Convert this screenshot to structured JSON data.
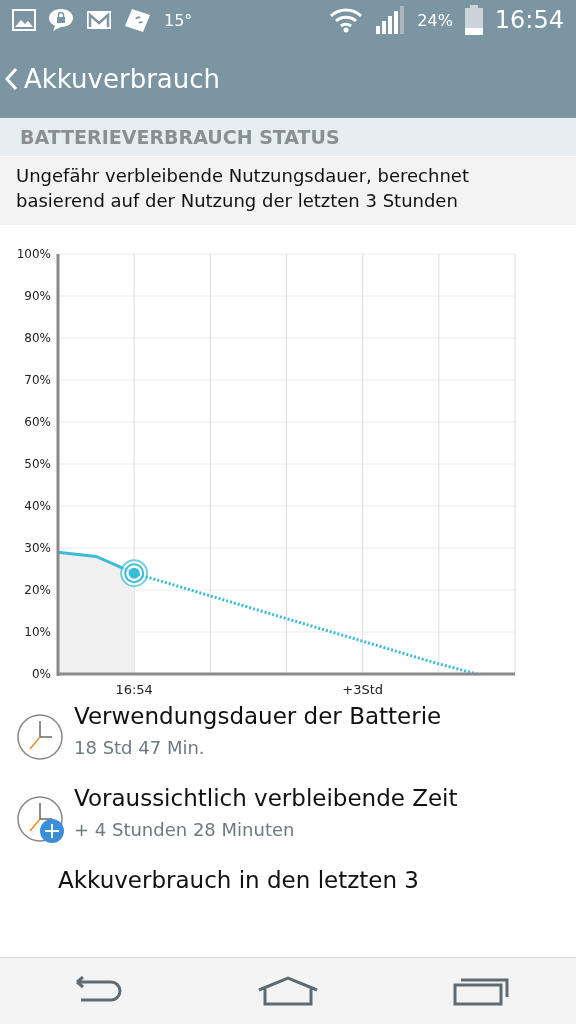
{
  "status_bar": {
    "temperature": "15°",
    "battery_percent": "24%",
    "time": "16:54"
  },
  "title_bar": {
    "title": "Akkuverbrauch"
  },
  "section_header": "BATTERIEVERBRAUCH STATUS",
  "description": "Ungefähr verbleibende Nutzungsdauer, berechnet basierend auf der Nutzung der letzten 3 Stunden",
  "chart": {
    "chart_data": {
      "type": "line",
      "categories": [
        null,
        null,
        "16:54",
        null,
        null,
        null,
        null,
        null,
        "+3Std",
        null,
        null,
        null,
        null
      ],
      "grid": true,
      "series": [
        {
          "color": "#3bbcd6",
          "line_style": "solid",
          "values": [
            29,
            28,
            24,
            null,
            null,
            null,
            null,
            null,
            null,
            null,
            null,
            null,
            null
          ]
        },
        {
          "color": "#3bbcd6",
          "line_style": "dotted",
          "values": [
            null,
            null,
            24,
            21.3,
            18.6,
            15.9,
            13.2,
            10.5,
            7.8,
            5.1,
            2.4,
            0,
            null
          ]
        }
      ],
      "ylim": [
        0,
        100
      ],
      "yticks": [
        {
          "value": 0,
          "label": "0%"
        },
        {
          "value": 10,
          "label": "10%"
        },
        {
          "value": 20,
          "label": "20%"
        },
        {
          "value": 30,
          "label": "30%"
        },
        {
          "value": 40,
          "label": "40%"
        },
        {
          "value": 50,
          "label": "50%"
        },
        {
          "value": 60,
          "label": "60%"
        },
        {
          "value": 70,
          "label": "70%"
        },
        {
          "value": 80,
          "label": "80%"
        },
        {
          "value": 90,
          "label": "90%"
        },
        {
          "value": 100,
          "label": "100%"
        }
      ]
    }
  },
  "items": [
    {
      "title": "Verwendungsdauer der Batterie",
      "subtitle": "18 Std 47 Min.",
      "kind": "clock"
    },
    {
      "title": "Voraussichtlich verbleibende Zeit",
      "subtitle": "+ 4 Stunden 28 Minuten",
      "kind": "clock-plus"
    },
    {
      "title": "Akkuverbrauch in den letzten 3",
      "kind": "plain"
    }
  ]
}
